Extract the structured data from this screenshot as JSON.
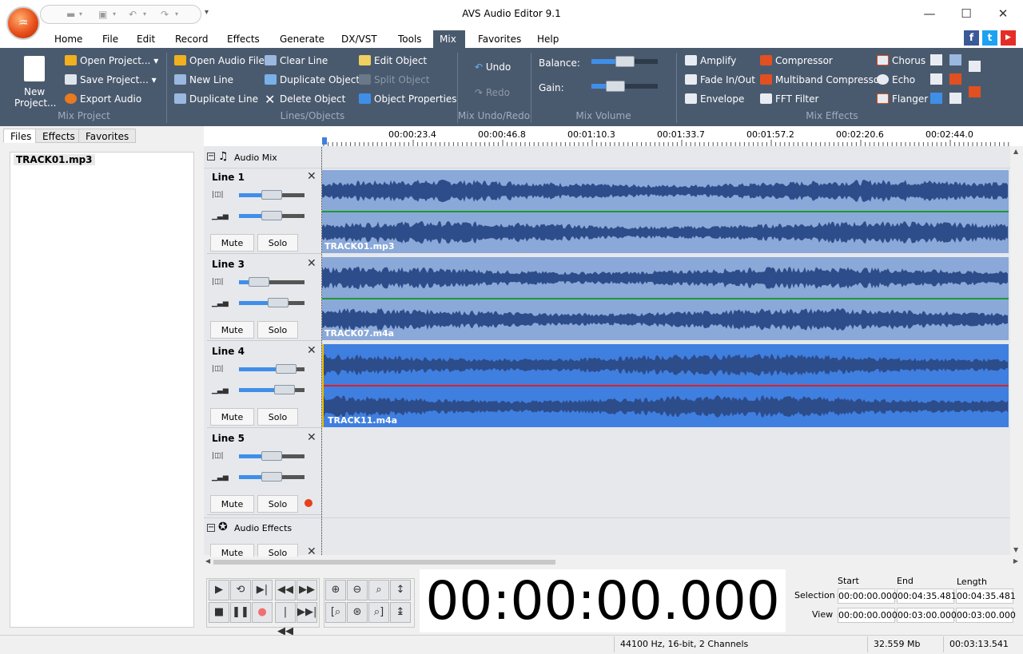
{
  "window": {
    "title": "AVS Audio Editor 9.1",
    "minimize": "—",
    "maximize": "☐",
    "close": "✕"
  },
  "menu": [
    "Home",
    "File",
    "Edit",
    "Record",
    "Effects",
    "Generate",
    "DX/VST",
    "Tools",
    "Mix",
    "Favorites",
    "Help"
  ],
  "menu_active": "Mix",
  "social": {
    "facebook": "f",
    "twitter": "t",
    "youtube": "▶"
  },
  "ribbon": {
    "mix_project": {
      "new": "New",
      "new2": "Project...",
      "open": "Open Project...",
      "save": "Save Project...",
      "export": "Export Audio",
      "group": "Mix Project"
    },
    "lines": {
      "open_file": "Open Audio File",
      "new_line": "New Line",
      "dup_line": "Duplicate Line",
      "clear_line": "Clear Line",
      "dup_obj": "Duplicate Object",
      "del_obj": "Delete Object",
      "edit_obj": "Edit Object",
      "split_obj": "Split Object",
      "obj_props": "Object Properties",
      "group": "Lines/Objects"
    },
    "undo": {
      "undo": "Undo",
      "redo": "Redo",
      "group": "Mix Undo/Redo"
    },
    "volume": {
      "balance": "Balance:",
      "gain": "Gain:",
      "group": "Mix Volume",
      "balance_value": 0.5,
      "gain_value": 0.5
    },
    "effects": {
      "amplify": "Amplify",
      "fade": "Fade In/Out",
      "envelope": "Envelope",
      "compressor": "Compressor",
      "multiband": "Multiband Compressor",
      "fft": "FFT Filter",
      "chorus": "Chorus",
      "echo": "Echo",
      "flanger": "Flanger",
      "group": "Mix Effects"
    }
  },
  "left_tabs": [
    "Files",
    "Effects",
    "Favorites"
  ],
  "files": [
    "TRACK01.mp3"
  ],
  "timeline": [
    "00:00:23.4",
    "00:00:46.8",
    "00:01:10.3",
    "00:01:33.7",
    "00:01:57.2",
    "00:02:20.6",
    "00:02:44.0"
  ],
  "audio_mix": "Audio Mix",
  "audio_effects": "Audio Effects",
  "lines": [
    {
      "name": "Line 1",
      "file": "TRACK01.mp3",
      "mute": "Mute",
      "solo": "Solo",
      "balance": 0.5,
      "gain": 0.5,
      "selected": false
    },
    {
      "name": "Line 3",
      "file": "TRACK07.m4a",
      "mute": "Mute",
      "solo": "Solo",
      "balance": 0.3,
      "gain": 0.6,
      "selected": false
    },
    {
      "name": "Line 4",
      "file": "TRACK11.m4a",
      "mute": "Mute",
      "solo": "Solo",
      "balance": 0.72,
      "gain": 0.7,
      "selected": true
    },
    {
      "name": "Line 5",
      "file": "",
      "mute": "Mute",
      "solo": "Solo",
      "balance": 0.5,
      "gain": 0.5,
      "selected": false
    }
  ],
  "effects_line": {
    "mute": "Mute",
    "solo": "Solo"
  },
  "clock": "00:00:00.000",
  "times": {
    "start_h": "Start",
    "end_h": "End",
    "length_h": "Length",
    "selection": "Selection",
    "view": "View",
    "sel_start": "00:00:00.000",
    "sel_end": "00:04:35.481",
    "sel_len": "00:04:35.481",
    "view_start": "00:00:00.000",
    "view_end": "00:03:00.000",
    "view_len": "00:03:00.000"
  },
  "status": {
    "format": "44100 Hz, 16-bit, 2 Channels",
    "size": "32.559 Mb",
    "duration": "00:03:13.541"
  },
  "colors": {
    "ribbon": "#4a5a6e",
    "wave_bg": "#8aa8d8",
    "wave_fg": "#2d4c8a",
    "wave_sel_bg": "#3f7fe0",
    "center_line": "#1e9a2e",
    "sel_line": "#e02020"
  }
}
